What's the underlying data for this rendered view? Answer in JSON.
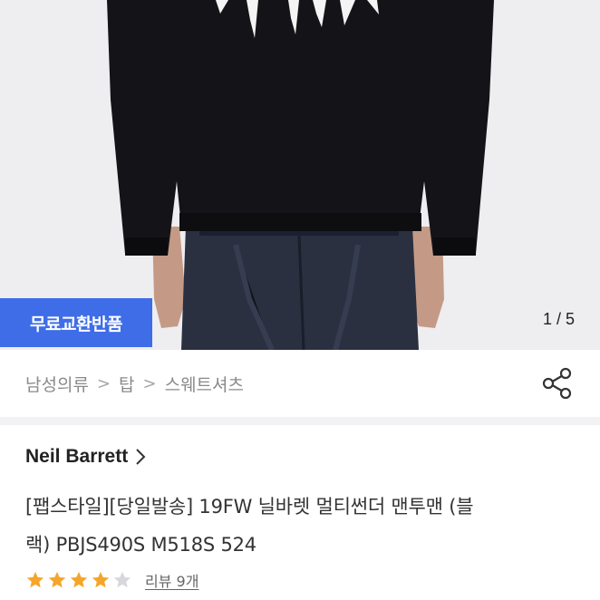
{
  "product_image": {
    "alt_icon": "sweatshirt-photo"
  },
  "badge": {
    "label": "무료교환반품",
    "color": "#3f6de8"
  },
  "pager": {
    "text": "1 / 5"
  },
  "breadcrumb": {
    "items": [
      "남성의류",
      "탑",
      "스웨트셔츠"
    ],
    "separator": ">"
  },
  "share": {
    "icon": "share-icon"
  },
  "brand": {
    "name": "Neil Barrett"
  },
  "product": {
    "title_line1": "[팹스타일][당일발송] 19FW 닐바렛 멀티썬더 맨투맨 (블",
    "title_line2": "랙) PBJS490S M518S 524"
  },
  "rating": {
    "score": 4,
    "max": 5,
    "star_color": "#f4a62a",
    "review_text": "리뷰 9개"
  }
}
